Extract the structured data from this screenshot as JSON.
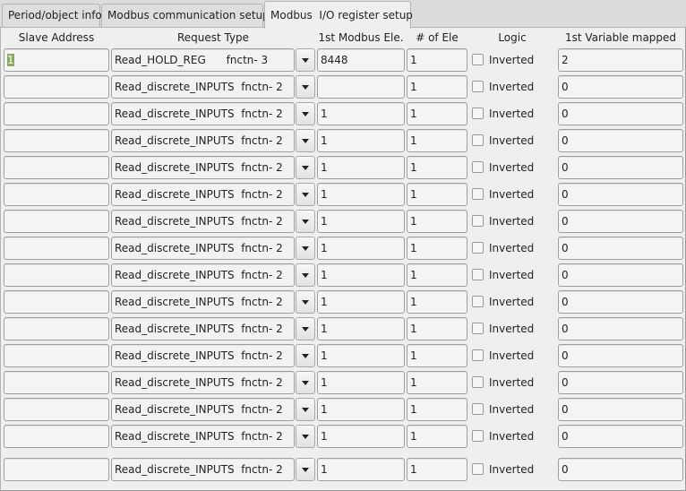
{
  "tabs": [
    {
      "label": "Period/object info",
      "active": false
    },
    {
      "label": "Modbus communication setup",
      "active": false
    },
    {
      "label": "Modbus  I/O register setup",
      "active": true
    }
  ],
  "columns": {
    "slave_address": "Slave Address",
    "request_type": "Request Type",
    "first_modbus_ele": "1st Modbus Ele.",
    "num_ele": "# of Ele",
    "logic": "Logic",
    "first_variable_mapped": "1st Variable mapped"
  },
  "rows": [
    {
      "slave": "1",
      "request": "Read_HOLD_REG      fnctn- 3",
      "first_ele": "8448",
      "num_ele": "1",
      "inverted": false,
      "logic_label": "Inverted",
      "first_var": "2"
    },
    {
      "slave": "",
      "request": "Read_discrete_INPUTS  fnctn- 2",
      "first_ele": "",
      "num_ele": "1",
      "inverted": false,
      "logic_label": "Inverted",
      "first_var": "0"
    },
    {
      "slave": "",
      "request": "Read_discrete_INPUTS  fnctn- 2",
      "first_ele": "1",
      "num_ele": "1",
      "inverted": false,
      "logic_label": "Inverted",
      "first_var": "0"
    },
    {
      "slave": "",
      "request": "Read_discrete_INPUTS  fnctn- 2",
      "first_ele": "1",
      "num_ele": "1",
      "inverted": false,
      "logic_label": "Inverted",
      "first_var": "0"
    },
    {
      "slave": "",
      "request": "Read_discrete_INPUTS  fnctn- 2",
      "first_ele": "1",
      "num_ele": "1",
      "inverted": false,
      "logic_label": "Inverted",
      "first_var": "0"
    },
    {
      "slave": "",
      "request": "Read_discrete_INPUTS  fnctn- 2",
      "first_ele": "1",
      "num_ele": "1",
      "inverted": false,
      "logic_label": "Inverted",
      "first_var": "0"
    },
    {
      "slave": "",
      "request": "Read_discrete_INPUTS  fnctn- 2",
      "first_ele": "1",
      "num_ele": "1",
      "inverted": false,
      "logic_label": "Inverted",
      "first_var": "0"
    },
    {
      "slave": "",
      "request": "Read_discrete_INPUTS  fnctn- 2",
      "first_ele": "1",
      "num_ele": "1",
      "inverted": false,
      "logic_label": "Inverted",
      "first_var": "0"
    },
    {
      "slave": "",
      "request": "Read_discrete_INPUTS  fnctn- 2",
      "first_ele": "1",
      "num_ele": "1",
      "inverted": false,
      "logic_label": "Inverted",
      "first_var": "0"
    },
    {
      "slave": "",
      "request": "Read_discrete_INPUTS  fnctn- 2",
      "first_ele": "1",
      "num_ele": "1",
      "inverted": false,
      "logic_label": "Inverted",
      "first_var": "0"
    },
    {
      "slave": "",
      "request": "Read_discrete_INPUTS  fnctn- 2",
      "first_ele": "1",
      "num_ele": "1",
      "inverted": false,
      "logic_label": "Inverted",
      "first_var": "0"
    },
    {
      "slave": "",
      "request": "Read_discrete_INPUTS  fnctn- 2",
      "first_ele": "1",
      "num_ele": "1",
      "inverted": false,
      "logic_label": "Inverted",
      "first_var": "0"
    },
    {
      "slave": "",
      "request": "Read_discrete_INPUTS  fnctn- 2",
      "first_ele": "1",
      "num_ele": "1",
      "inverted": false,
      "logic_label": "Inverted",
      "first_var": "0"
    },
    {
      "slave": "",
      "request": "Read_discrete_INPUTS  fnctn- 2",
      "first_ele": "1",
      "num_ele": "1",
      "inverted": false,
      "logic_label": "Inverted",
      "first_var": "0"
    },
    {
      "slave": "",
      "request": "Read_discrete_INPUTS  fnctn- 2",
      "first_ele": "1",
      "num_ele": "1",
      "inverted": false,
      "logic_label": "Inverted",
      "first_var": "0"
    },
    {
      "slave": "",
      "request": "Read_discrete_INPUTS  fnctn- 2",
      "first_ele": "1",
      "num_ele": "1",
      "inverted": false,
      "logic_label": "Inverted",
      "first_var": "0"
    }
  ],
  "selection_color": "#8aa864"
}
